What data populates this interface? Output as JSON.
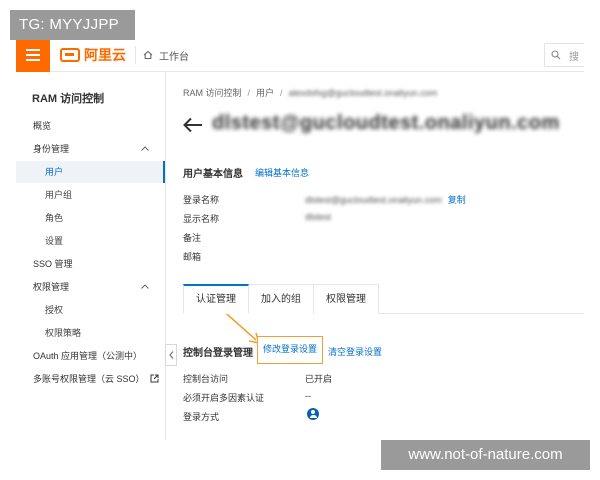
{
  "watermarks": {
    "top": "TG: MYYJJPP",
    "bottom": "www.not-of-nature.com"
  },
  "topbar": {
    "brand": "阿里云",
    "workbench": "工作台",
    "search_placeholder": "搜"
  },
  "sidebar": {
    "title": "RAM 访问控制",
    "items": [
      {
        "label": "概览",
        "level": 1
      },
      {
        "label": "身份管理",
        "level": 1,
        "expanded": true
      },
      {
        "label": "用户",
        "level": 2,
        "active": true
      },
      {
        "label": "用户组",
        "level": 2
      },
      {
        "label": "角色",
        "level": 2
      },
      {
        "label": "设置",
        "level": 2
      },
      {
        "label": "SSO 管理",
        "level": 1
      },
      {
        "label": "权限管理",
        "level": 1,
        "expanded": true
      },
      {
        "label": "授权",
        "level": 2
      },
      {
        "label": "权限策略",
        "level": 2
      },
      {
        "label": "OAuth 应用管理（公测中）",
        "level": 1
      },
      {
        "label": "多账号权限管理（云 SSO）",
        "level": 1,
        "external": true
      }
    ]
  },
  "breadcrumb": {
    "root": "RAM 访问控制",
    "section": "用户",
    "current": "alexdsfsg@gucloudtest.onaliyun.com"
  },
  "user": {
    "title": "dlstest@gucloudtest.onaliyun.com"
  },
  "basic_info": {
    "heading": "用户基本信息",
    "edit_label": "编辑基本信息",
    "fields": [
      {
        "label": "登录名称",
        "value": "dlstest@gucloudtest.onaliyun.com",
        "action": "复制"
      },
      {
        "label": "显示名称",
        "value": "dlstest"
      },
      {
        "label": "备注",
        "value": ""
      },
      {
        "label": "邮箱",
        "value": ""
      }
    ]
  },
  "tabs": [
    {
      "label": "认证管理",
      "active": true
    },
    {
      "label": "加入的组"
    },
    {
      "label": "权限管理"
    }
  ],
  "console_login": {
    "heading": "控制台登录管理",
    "modify_label": "修改登录设置",
    "clear_label": "清空登录设置",
    "rows": [
      {
        "label": "控制台访问",
        "value": "已开启"
      },
      {
        "label": "必须开启多因素认证",
        "value": "--"
      },
      {
        "label": "登录方式",
        "value": ""
      }
    ]
  },
  "colors": {
    "brand": "#ff6a00",
    "link": "#0070cc",
    "highlight_box": "#f0a030"
  }
}
